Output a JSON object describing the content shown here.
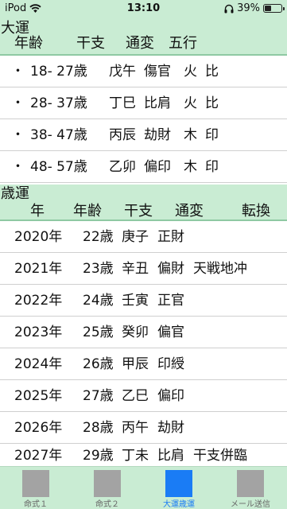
{
  "status_bar": {
    "carrier": "iPod",
    "time": "13:10",
    "battery_percent": "39%",
    "battery_level": 0.39
  },
  "taiun": {
    "title": "大運",
    "columns": [
      "年齢",
      "干支",
      "通変",
      "五行"
    ],
    "rows": [
      {
        "bullet": "・",
        "age": "18- 27歳",
        "kanshi": "戊午",
        "tsuhen": "傷官",
        "gogyo1": "火",
        "gogyo2": "比"
      },
      {
        "bullet": "・",
        "age": "28- 37歳",
        "kanshi": "丁巳",
        "tsuhen": "比肩",
        "gogyo1": "火",
        "gogyo2": "比"
      },
      {
        "bullet": "・",
        "age": "38- 47歳",
        "kanshi": "丙辰",
        "tsuhen": "劫財",
        "gogyo1": "木",
        "gogyo2": "印"
      },
      {
        "bullet": "・",
        "age": "48- 57歳",
        "kanshi": "乙卯",
        "tsuhen": "偏印",
        "gogyo1": "木",
        "gogyo2": "印"
      }
    ]
  },
  "saiun": {
    "title": "歳運",
    "columns": [
      "年",
      "年齢",
      "干支",
      "通変",
      "転換"
    ],
    "rows": [
      {
        "year": "2020年",
        "age": "22歳",
        "kanshi": "庚子",
        "tsuhen": "正財",
        "tenkan": ""
      },
      {
        "year": "2021年",
        "age": "23歳",
        "kanshi": "辛丑",
        "tsuhen": "偏財",
        "tenkan": "天戦地冲"
      },
      {
        "year": "2022年",
        "age": "24歳",
        "kanshi": "壬寅",
        "tsuhen": "正官",
        "tenkan": ""
      },
      {
        "year": "2023年",
        "age": "25歳",
        "kanshi": "癸卯",
        "tsuhen": "偏官",
        "tenkan": ""
      },
      {
        "year": "2024年",
        "age": "26歳",
        "kanshi": "甲辰",
        "tsuhen": "印綬",
        "tenkan": ""
      },
      {
        "year": "2025年",
        "age": "27歳",
        "kanshi": "乙巳",
        "tsuhen": "偏印",
        "tenkan": ""
      },
      {
        "year": "2026年",
        "age": "28歳",
        "kanshi": "丙午",
        "tsuhen": "劫財",
        "tenkan": ""
      },
      {
        "year": "2027年",
        "age": "29歳",
        "kanshi": "丁未",
        "tsuhen": "比肩",
        "tenkan": "干支併臨"
      }
    ]
  },
  "tabs": [
    {
      "label": "命式１",
      "active": false
    },
    {
      "label": "命式２",
      "active": false
    },
    {
      "label": "大運歳運",
      "active": true
    },
    {
      "label": "メール送信",
      "active": false
    }
  ],
  "colors": {
    "header_bg": "#c9ecd3",
    "accent": "#1a7cf5",
    "icon_inactive": "#a3a3a3"
  }
}
